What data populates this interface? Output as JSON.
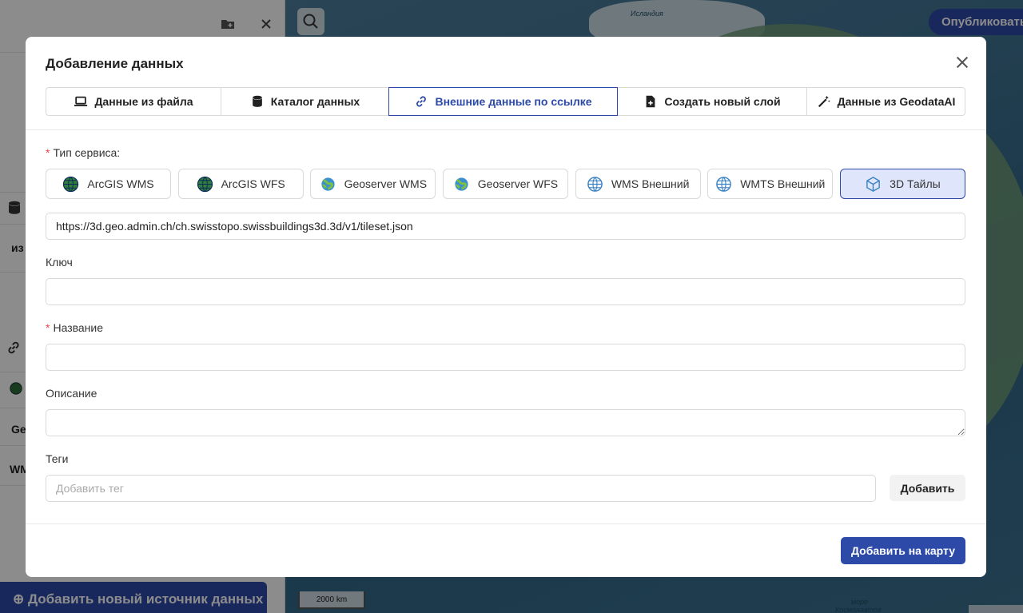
{
  "background": {
    "publish_label": "Опубликовать",
    "add_source_label": "Добавить новый источник данных",
    "left_fragments": [
      "из",
      "Ge",
      "WM"
    ],
    "scale_label": "2000 km",
    "map_labels": [
      "Исландия",
      "море",
      "Космонавтов"
    ]
  },
  "modal": {
    "title": "Добавление данных",
    "tabs": [
      {
        "label": "Данные из файла",
        "icon": "laptop-icon"
      },
      {
        "label": "Каталог данных",
        "icon": "database-icon"
      },
      {
        "label": "Внешние данные по ссылке",
        "icon": "link-icon",
        "active": true
      },
      {
        "label": "Создать новый слой",
        "icon": "file-plus-icon"
      },
      {
        "label": "Данные из GeodataAI",
        "icon": "magic-wand-icon"
      }
    ],
    "service_type_label": "Тип сервиса:",
    "services": [
      {
        "label": "ArcGIS WMS",
        "icon": "arcgis-globe-icon"
      },
      {
        "label": "ArcGIS WFS",
        "icon": "arcgis-globe-icon"
      },
      {
        "label": "Geoserver WMS",
        "icon": "geoserver-icon"
      },
      {
        "label": "Geoserver WFS",
        "icon": "geoserver-icon"
      },
      {
        "label": "WMS Внешний",
        "icon": "globe-icon"
      },
      {
        "label": "WMTS Внешний",
        "icon": "globe-icon"
      },
      {
        "label": "3D Тайлы",
        "icon": "cube-icon",
        "active": true
      }
    ],
    "url_value": "https://3d.geo.admin.ch/ch.swisstopo.swissbuildings3d.3d/v1/tileset.json",
    "key_label": "Ключ",
    "key_value": "",
    "name_label": "Название",
    "name_value": "",
    "description_label": "Описание",
    "description_value": "",
    "tags_label": "Теги",
    "tags_placeholder": "Добавить тег",
    "add_tag_label": "Добавить",
    "submit_label": "Добавить на карту"
  },
  "colors": {
    "primary": "#2d4aa8",
    "active_service_bg": "#dfe5fb",
    "required": "#e44"
  }
}
